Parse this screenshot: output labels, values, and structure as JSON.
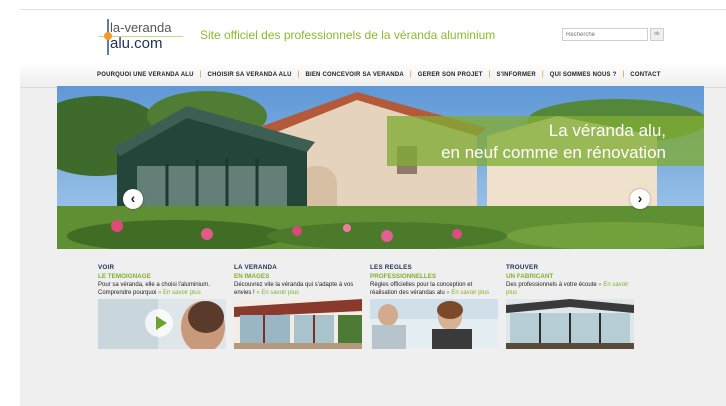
{
  "header": {
    "logo_line1": "la-veranda",
    "logo_line2": "alu.com",
    "tagline": "Site officiel des professionnels de la véranda aluminium",
    "search_placeholder": "Recherche",
    "search_button": "ok"
  },
  "nav": {
    "items": [
      "POURQUOI UNE VERANDA ALU",
      "CHOISIR SA VERANDA ALU",
      "BIEN CONCEVOIR SA VERANDA",
      "GERER SON PROJET",
      "S'INFORMER",
      "QUI SOMMES NOUS ?",
      "CONTACT"
    ],
    "separator": "|"
  },
  "hero": {
    "caption_line1": "La véranda alu,",
    "caption_line2": "en neuf comme en rénovation",
    "prev_icon": "chevron-left-icon",
    "next_icon": "chevron-right-icon",
    "prev_glyph": "‹",
    "next_glyph": "›"
  },
  "blocks": [
    {
      "category": "VOIR",
      "subtitle": "LE TEMOIGNAGE",
      "description": "Pour sa véranda, elle a choisi l'aluminium. Comprendre pourquoi",
      "more": "» En savoir plus",
      "media_icon": "play-icon"
    },
    {
      "category": "LA VERANDA",
      "subtitle": "EN IMAGES",
      "description": "Découvrez vite la véranda qui s'adapte à vos envies !",
      "more": "» En savoir plus"
    },
    {
      "category": "LES REGLES",
      "subtitle": "PROFESSIONNELLES",
      "description": "Règles officielles pour la conception et réalisation des vérandas alu",
      "more": "» En savoir plus"
    },
    {
      "category": "TROUVER",
      "subtitle": "UN FABRICANT",
      "description": "Des professionnels à votre écoute",
      "more": "» En savoir plus"
    }
  ],
  "colors": {
    "brand_green": "#7db02e",
    "brand_navy": "#1e2f55",
    "nav_separator": "#e07a1a"
  }
}
